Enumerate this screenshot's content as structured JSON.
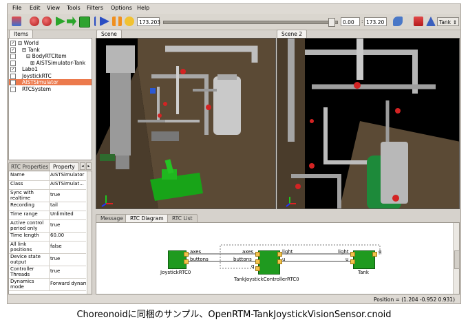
{
  "menu": [
    "File",
    "Edit",
    "View",
    "Tools",
    "Filters",
    "Options",
    "Help"
  ],
  "toolbar": {
    "time_value": "173.203",
    "range_start": "0.00",
    "range_end": "173.20",
    "body_select": "Tank",
    "accent": "#e0e0dc"
  },
  "items_panel": {
    "tab": "Items",
    "tree": [
      {
        "label": "World",
        "checked": true,
        "indent": 0,
        "expand": "⊟"
      },
      {
        "label": "Tank",
        "checked": true,
        "indent": 1,
        "expand": "⊟"
      },
      {
        "label": "BodyRTCItem",
        "checked": false,
        "indent": 2,
        "expand": "⊟"
      },
      {
        "label": "AISTSimulator-Tank",
        "checked": false,
        "indent": 3,
        "expand": "⊞"
      },
      {
        "label": "Labo1",
        "checked": true,
        "indent": 1,
        "expand": ""
      },
      {
        "label": "JoystickRTC",
        "checked": false,
        "indent": 1,
        "expand": ""
      },
      {
        "label": "AISTSimulator",
        "checked": false,
        "indent": 1,
        "expand": "",
        "selected": true
      },
      {
        "label": "RTCSystem",
        "checked": false,
        "indent": 1,
        "expand": ""
      }
    ]
  },
  "properties_panel": {
    "tabs": [
      "RTC Properties",
      "Property"
    ],
    "rows": [
      {
        "name": "Name",
        "value": "AISTSimulator"
      },
      {
        "name": "Class",
        "value": "AISTSimulat..."
      },
      {
        "name": "Sync with realtime",
        "value": "true"
      },
      {
        "name": "Recording",
        "value": "tail"
      },
      {
        "name": "Time range",
        "value": "Unlimited"
      },
      {
        "name": "Active control period only",
        "value": "true"
      },
      {
        "name": "Time length",
        "value": "60.00"
      },
      {
        "name": "All link positions",
        "value": "false"
      },
      {
        "name": "Device state output",
        "value": "true"
      },
      {
        "name": "Controller Threads",
        "value": "true"
      },
      {
        "name": "Dynamics mode",
        "value": "Forward dynamics"
      }
    ]
  },
  "scenes": {
    "scene1_tab": "Scene",
    "scene2_tab": "Scene 2"
  },
  "bottom_tabs": [
    "Message",
    "RTC Diagram",
    "RTC List"
  ],
  "rtc_diagram": {
    "joystick": {
      "name": "JoystickRTC0",
      "out_ports": [
        "axes",
        "buttons"
      ]
    },
    "controller": {
      "name": "TankJoystickControllerRTC0",
      "in_ports": [
        "axes",
        "buttons",
        "q"
      ],
      "out_ports": [
        "light",
        "u"
      ]
    },
    "tank": {
      "name": "Tank",
      "in_ports": [
        "light",
        "u"
      ],
      "out_ports": [
        "q"
      ]
    }
  },
  "status": {
    "position": "Position = (1.204 -0.952 0.931)"
  },
  "caption": "Choreonoidに同梱のサンプル、OpenRTM-TankJoystickVisionSensor.cnoid"
}
